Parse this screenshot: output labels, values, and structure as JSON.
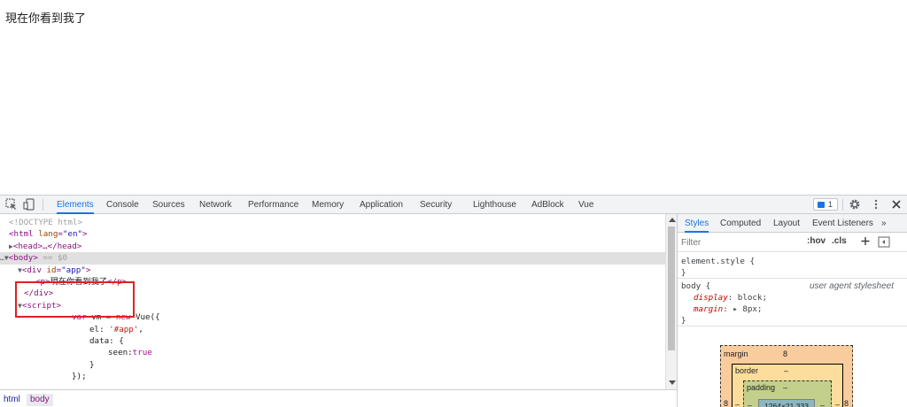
{
  "page": {
    "text": "現在你看到我了"
  },
  "devtools": {
    "tabs": [
      "Elements",
      "Console",
      "Sources",
      "Network",
      "Performance",
      "Memory",
      "Application",
      "Security",
      "Lighthouse",
      "AdBlock",
      "Vue"
    ],
    "active_tab": "Elements",
    "issues_count": "1",
    "elements": {
      "doctype": "<!DOCTYPE html>",
      "html_open_tag": "<html",
      "html_attr_name": "lang",
      "html_attr_value": "\"en\"",
      "head": "<head>…</head>",
      "body_tag": "<body>",
      "body_suffix": " == $0",
      "div_open": "<div",
      "div_attr_name": "id",
      "div_attr_value": "\"app\"",
      "p_open": "<p>",
      "p_text": "現在你看到我了",
      "p_close": "</p>",
      "div_close": "</div>",
      "script_tag": "<script>",
      "code_var": "var",
      "code_vm": " vm = ",
      "code_new": "new",
      "code_vue": " Vue({",
      "code_el_key": "el: ",
      "code_el_val": "'#app'",
      "code_el_comma": ",",
      "code_data": "data: {",
      "code_seen_key": "seen:",
      "code_seen_val": "true",
      "code_close_brace": "}",
      "code_close_all": "});"
    },
    "breadcrumb": [
      "html",
      "body"
    ],
    "styles": {
      "tabs": [
        "Styles",
        "Computed",
        "Layout",
        "Event Listeners",
        "»"
      ],
      "active_tab": "Styles",
      "filter_placeholder": "Filter",
      "hov": ":hov",
      "cls": ".cls",
      "element_style_selector": "element.style {",
      "close_brace": "}",
      "body_selector": "body {",
      "ua_label": "user agent stylesheet",
      "prop1_name": "display",
      "prop1_value": ": block;",
      "prop2_name": "margin",
      "prop2_value": ": ▸ 8px;"
    },
    "box_model": {
      "margin_label": "margin",
      "margin_value": "8",
      "border_label": "border",
      "border_value": "–",
      "padding_label": "padding",
      "padding_value": "–",
      "content_value": "1264×21.333",
      "side_margin": "8",
      "side_border": "–",
      "side_padding": "–"
    }
  }
}
